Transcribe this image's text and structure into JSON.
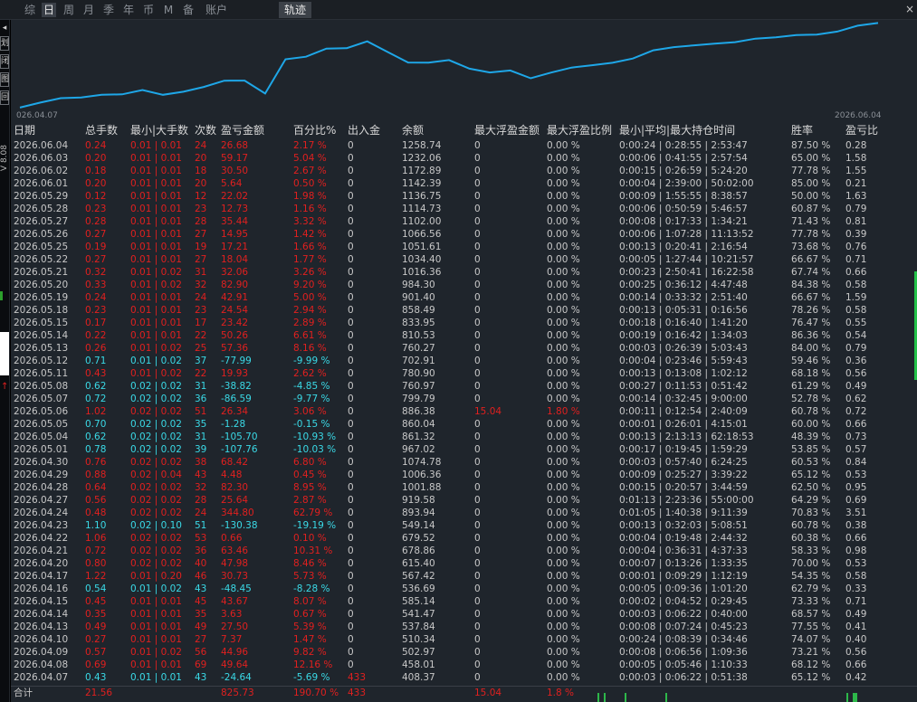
{
  "tabs": [
    "综",
    "日",
    "周",
    "月",
    "季",
    "年",
    "币",
    "M",
    "备",
    "账户"
  ],
  "active_tab": "日",
  "panel_title": "轨迹",
  "close_glyph": "×",
  "left_strip": {
    "arrow": "◂",
    "buttons": [
      "划",
      "闭",
      "图",
      "回"
    ],
    "version": "V 8.08",
    "red_arrow": "↑"
  },
  "colors": {
    "background": "#000000",
    "panel": "#1f252c",
    "line": "#1ea7e8",
    "positive": "#e0201f",
    "negative": "#3ad9e6",
    "neutral": "#c8c8c8"
  },
  "chart_data": {
    "type": "line",
    "title": "",
    "x_start_label": "026.04.07",
    "x_end_label": "2026.06.04",
    "x": [
      "2026.04.07",
      "2026.04.09",
      "2026.04.10",
      "2026.04.13",
      "2026.04.14",
      "2026.04.15",
      "2026.04.16",
      "2026.04.17",
      "2026.04.20",
      "2026.04.21",
      "2026.04.22",
      "2026.04.23",
      "2026.04.24",
      "2026.04.27",
      "2026.04.28",
      "2026.04.29",
      "2026.04.30",
      "2026.05.01",
      "2026.05.04",
      "2026.05.05",
      "2026.05.06",
      "2026.05.07",
      "2026.05.08",
      "2026.05.11",
      "2026.05.12",
      "2026.05.13",
      "2026.05.14",
      "2026.05.15",
      "2026.05.18",
      "2026.05.19",
      "2026.05.20",
      "2026.05.21",
      "2026.05.22",
      "2026.05.25",
      "2026.05.26",
      "2026.05.27",
      "2026.05.28",
      "2026.05.29",
      "2026.06.01",
      "2026.06.02",
      "2026.06.03",
      "2026.06.04"
    ],
    "y": [
      408.37,
      458.01,
      502.97,
      510.34,
      537.84,
      541.47,
      585.14,
      536.69,
      567.42,
      615.4,
      678.86,
      679.52,
      549.14,
      893.94,
      919.58,
      1001.88,
      1006.36,
      1074.78,
      967.02,
      861.32,
      860.04,
      886.38,
      799.79,
      760.97,
      780.9,
      702.91,
      760.27,
      810.53,
      833.95,
      858.49,
      901.4,
      984.3,
      1016.36,
      1034.4,
      1051.61,
      1066.56,
      1102.0,
      1114.73,
      1136.75,
      1142.39,
      1172.89,
      1232.06,
      1258.74
    ],
    "ylim": [
      380,
      1290
    ],
    "grid": false
  },
  "table": {
    "headers": [
      "日期",
      "总手数",
      "最小|大手数",
      "次数",
      "盈亏金额",
      "百分比%",
      "出入金",
      "余额",
      "最大浮盈金额",
      "最大浮盈比例",
      "最小|平均|最大持仓时间",
      "胜率",
      "盈亏比"
    ],
    "rows": [
      [
        "2026.06.04",
        "0.24",
        "0.01 | 0.01",
        "24",
        "26.68",
        "2.17 %",
        "0",
        "1258.74",
        "0",
        "0.00 %",
        "0:00:24 | 0:28:55 | 2:53:47",
        "87.50 %",
        "0.28",
        "pos"
      ],
      [
        "2026.06.03",
        "0.20",
        "0.01 | 0.01",
        "20",
        "59.17",
        "5.04 %",
        "0",
        "1232.06",
        "0",
        "0.00 %",
        "0:00:06 | 0:41:55 | 2:57:54",
        "65.00 %",
        "1.58",
        "pos"
      ],
      [
        "2026.06.02",
        "0.18",
        "0.01 | 0.01",
        "18",
        "30.50",
        "2.67 %",
        "0",
        "1172.89",
        "0",
        "0.00 %",
        "0:00:15 | 0:26:59 | 5:24:20",
        "77.78 %",
        "1.55",
        "pos"
      ],
      [
        "2026.06.01",
        "0.20",
        "0.01 | 0.01",
        "20",
        "5.64",
        "0.50 %",
        "0",
        "1142.39",
        "0",
        "0.00 %",
        "0:00:04 | 2:39:00 | 50:02:00",
        "85.00 %",
        "0.21",
        "pos"
      ],
      [
        "2026.05.29",
        "0.12",
        "0.01 | 0.01",
        "12",
        "22.02",
        "1.98 %",
        "0",
        "1136.75",
        "0",
        "0.00 %",
        "0:00:09 | 1:55:55 | 8:38:57",
        "50.00 %",
        "1.63",
        "pos"
      ],
      [
        "2026.05.28",
        "0.23",
        "0.01 | 0.01",
        "23",
        "12.73",
        "1.16 %",
        "0",
        "1114.73",
        "0",
        "0.00 %",
        "0:00:06 | 0:50:59 | 5:46:57",
        "60.87 %",
        "0.79",
        "pos"
      ],
      [
        "2026.05.27",
        "0.28",
        "0.01 | 0.01",
        "28",
        "35.44",
        "3.32 %",
        "0",
        "1102.00",
        "0",
        "0.00 %",
        "0:00:08 | 0:17:33 | 1:34:21",
        "71.43 %",
        "0.81",
        "pos"
      ],
      [
        "2026.05.26",
        "0.27",
        "0.01 | 0.01",
        "27",
        "14.95",
        "1.42 %",
        "0",
        "1066.56",
        "0",
        "0.00 %",
        "0:00:06 | 1:07:28 | 11:13:52",
        "77.78 %",
        "0.39",
        "pos"
      ],
      [
        "2026.05.25",
        "0.19",
        "0.01 | 0.01",
        "19",
        "17.21",
        "1.66 %",
        "0",
        "1051.61",
        "0",
        "0.00 %",
        "0:00:13 | 0:20:41 | 2:16:54",
        "73.68 %",
        "0.76",
        "pos"
      ],
      [
        "2026.05.22",
        "0.27",
        "0.01 | 0.01",
        "27",
        "18.04",
        "1.77 %",
        "0",
        "1034.40",
        "0",
        "0.00 %",
        "0:00:05 | 1:27:44 | 10:21:57",
        "66.67 %",
        "0.71",
        "pos"
      ],
      [
        "2026.05.21",
        "0.32",
        "0.01 | 0.02",
        "31",
        "32.06",
        "3.26 %",
        "0",
        "1016.36",
        "0",
        "0.00 %",
        "0:00:23 | 2:50:41 | 16:22:58",
        "67.74 %",
        "0.66",
        "pos"
      ],
      [
        "2026.05.20",
        "0.33",
        "0.01 | 0.02",
        "32",
        "82.90",
        "9.20 %",
        "0",
        "984.30",
        "0",
        "0.00 %",
        "0:00:25 | 0:36:12 | 4:47:48",
        "84.38 %",
        "0.58",
        "pos"
      ],
      [
        "2026.05.19",
        "0.24",
        "0.01 | 0.01",
        "24",
        "42.91",
        "5.00 %",
        "0",
        "901.40",
        "0",
        "0.00 %",
        "0:00:14 | 0:33:32 | 2:51:40",
        "66.67 %",
        "1.59",
        "pos"
      ],
      [
        "2026.05.18",
        "0.23",
        "0.01 | 0.01",
        "23",
        "24.54",
        "2.94 %",
        "0",
        "858.49",
        "0",
        "0.00 %",
        "0:00:13 | 0:05:31 | 0:16:56",
        "78.26 %",
        "0.58",
        "pos"
      ],
      [
        "2026.05.15",
        "0.17",
        "0.01 | 0.01",
        "17",
        "23.42",
        "2.89 %",
        "0",
        "833.95",
        "0",
        "0.00 %",
        "0:00:18 | 0:16:40 | 1:41:20",
        "76.47 %",
        "0.55",
        "pos"
      ],
      [
        "2026.05.14",
        "0.22",
        "0.01 | 0.01",
        "22",
        "50.26",
        "6.61 %",
        "0",
        "810.53",
        "0",
        "0.00 %",
        "0:00:19 | 0:16:42 | 1:34:03",
        "86.36 %",
        "0.54",
        "pos"
      ],
      [
        "2026.05.13",
        "0.26",
        "0.01 | 0.02",
        "25",
        "57.36",
        "8.16 %",
        "0",
        "760.27",
        "0",
        "0.00 %",
        "0:00:03 | 0:26:39 | 5:03:43",
        "84.00 %",
        "0.79",
        "pos"
      ],
      [
        "2026.05.12",
        "0.71",
        "0.01 | 0.02",
        "37",
        "-77.99",
        "-9.99 %",
        "0",
        "702.91",
        "0",
        "0.00 %",
        "0:00:04 | 0:23:46 | 5:59:43",
        "59.46 %",
        "0.36",
        "neg"
      ],
      [
        "2026.05.11",
        "0.43",
        "0.01 | 0.02",
        "22",
        "19.93",
        "2.62 %",
        "0",
        "780.90",
        "0",
        "0.00 %",
        "0:00:13 | 0:13:08 | 1:02:12",
        "68.18 %",
        "0.56",
        "pos"
      ],
      [
        "2026.05.08",
        "0.62",
        "0.02 | 0.02",
        "31",
        "-38.82",
        "-4.85 %",
        "0",
        "760.97",
        "0",
        "0.00 %",
        "0:00:27 | 0:11:53 | 0:51:42",
        "61.29 %",
        "0.49",
        "neg"
      ],
      [
        "2026.05.07",
        "0.72",
        "0.02 | 0.02",
        "36",
        "-86.59",
        "-9.77 %",
        "0",
        "799.79",
        "0",
        "0.00 %",
        "0:00:14 | 0:32:45 | 9:00:00",
        "52.78 %",
        "0.62",
        "neg"
      ],
      [
        "2026.05.06",
        "1.02",
        "0.02 | 0.02",
        "51",
        "26.34",
        "3.06 %",
        "0",
        "886.38",
        "15.04",
        "1.80 %",
        "0:00:11 | 0:12:54 | 2:40:09",
        "60.78 %",
        "0.72",
        "pos"
      ],
      [
        "2026.05.05",
        "0.70",
        "0.02 | 0.02",
        "35",
        "-1.28",
        "-0.15 %",
        "0",
        "860.04",
        "0",
        "0.00 %",
        "0:00:01 | 0:26:01 | 4:15:01",
        "60.00 %",
        "0.66",
        "neg"
      ],
      [
        "2026.05.04",
        "0.62",
        "0.02 | 0.02",
        "31",
        "-105.70",
        "-10.93 %",
        "0",
        "861.32",
        "0",
        "0.00 %",
        "0:00:13 | 2:13:13 | 62:18:53",
        "48.39 %",
        "0.73",
        "neg"
      ],
      [
        "2026.05.01",
        "0.78",
        "0.02 | 0.02",
        "39",
        "-107.76",
        "-10.03 %",
        "0",
        "967.02",
        "0",
        "0.00 %",
        "0:00:17 | 0:19:45 | 1:59:29",
        "53.85 %",
        "0.57",
        "neg"
      ],
      [
        "2026.04.30",
        "0.76",
        "0.02 | 0.02",
        "38",
        "68.42",
        "6.80 %",
        "0",
        "1074.78",
        "0",
        "0.00 %",
        "0:00:03 | 0:57:40 | 6:24:25",
        "60.53 %",
        "0.84",
        "pos"
      ],
      [
        "2026.04.29",
        "0.88",
        "0.02 | 0.04",
        "43",
        "4.48",
        "0.45 %",
        "0",
        "1006.36",
        "0",
        "0.00 %",
        "0:00:09 | 0:25:27 | 3:39:22",
        "65.12 %",
        "0.53",
        "pos"
      ],
      [
        "2026.04.28",
        "0.64",
        "0.02 | 0.02",
        "32",
        "82.30",
        "8.95 %",
        "0",
        "1001.88",
        "0",
        "0.00 %",
        "0:00:15 | 0:20:57 | 3:44:59",
        "62.50 %",
        "0.95",
        "pos"
      ],
      [
        "2026.04.27",
        "0.56",
        "0.02 | 0.02",
        "28",
        "25.64",
        "2.87 %",
        "0",
        "919.58",
        "0",
        "0.00 %",
        "0:01:13 | 2:23:36 | 55:00:00",
        "64.29 %",
        "0.69",
        "pos"
      ],
      [
        "2026.04.24",
        "0.48",
        "0.02 | 0.02",
        "24",
        "344.80",
        "62.79 %",
        "0",
        "893.94",
        "0",
        "0.00 %",
        "0:01:05 | 1:40:38 | 9:11:39",
        "70.83 %",
        "3.51",
        "pos"
      ],
      [
        "2026.04.23",
        "1.10",
        "0.02 | 0.10",
        "51",
        "-130.38",
        "-19.19 %",
        "0",
        "549.14",
        "0",
        "0.00 %",
        "0:00:13 | 0:32:03 | 5:08:51",
        "60.78 %",
        "0.38",
        "neg"
      ],
      [
        "2026.04.22",
        "1.06",
        "0.02 | 0.02",
        "53",
        "0.66",
        "0.10 %",
        "0",
        "679.52",
        "0",
        "0.00 %",
        "0:00:04 | 0:19:48 | 2:44:32",
        "60.38 %",
        "0.66",
        "pos"
      ],
      [
        "2026.04.21",
        "0.72",
        "0.02 | 0.02",
        "36",
        "63.46",
        "10.31 %",
        "0",
        "678.86",
        "0",
        "0.00 %",
        "0:00:04 | 0:36:31 | 4:37:33",
        "58.33 %",
        "0.98",
        "pos"
      ],
      [
        "2026.04.20",
        "0.80",
        "0.02 | 0.02",
        "40",
        "47.98",
        "8.46 %",
        "0",
        "615.40",
        "0",
        "0.00 %",
        "0:00:07 | 0:13:26 | 1:33:35",
        "70.00 %",
        "0.53",
        "pos"
      ],
      [
        "2026.04.17",
        "1.22",
        "0.01 | 0.20",
        "46",
        "30.73",
        "5.73 %",
        "0",
        "567.42",
        "0",
        "0.00 %",
        "0:00:01 | 0:09:29 | 1:12:19",
        "54.35 %",
        "0.58",
        "pos"
      ],
      [
        "2026.04.16",
        "0.54",
        "0.01 | 0.02",
        "43",
        "-48.45",
        "-8.28 %",
        "0",
        "536.69",
        "0",
        "0.00 %",
        "0:00:05 | 0:09:36 | 1:01:20",
        "62.79 %",
        "0.33",
        "neg"
      ],
      [
        "2026.04.15",
        "0.45",
        "0.01 | 0.01",
        "45",
        "43.67",
        "8.07 %",
        "0",
        "585.14",
        "0",
        "0.00 %",
        "0:00:02 | 0:04:52 | 0:29:45",
        "73.33 %",
        "0.71",
        "pos"
      ],
      [
        "2026.04.14",
        "0.35",
        "0.01 | 0.01",
        "35",
        "3.63",
        "0.67 %",
        "0",
        "541.47",
        "0",
        "0.00 %",
        "0:00:03 | 0:06:22 | 0:40:00",
        "68.57 %",
        "0.49",
        "pos"
      ],
      [
        "2026.04.13",
        "0.49",
        "0.01 | 0.01",
        "49",
        "27.50",
        "5.39 %",
        "0",
        "537.84",
        "0",
        "0.00 %",
        "0:00:08 | 0:07:24 | 0:45:23",
        "77.55 %",
        "0.41",
        "pos"
      ],
      [
        "2026.04.10",
        "0.27",
        "0.01 | 0.01",
        "27",
        "7.37",
        "1.47 %",
        "0",
        "510.34",
        "0",
        "0.00 %",
        "0:00:24 | 0:08:39 | 0:34:46",
        "74.07 %",
        "0.40",
        "pos"
      ],
      [
        "2026.04.09",
        "0.57",
        "0.01 | 0.02",
        "56",
        "44.96",
        "9.82 %",
        "0",
        "502.97",
        "0",
        "0.00 %",
        "0:00:08 | 0:06:56 | 1:09:36",
        "73.21 %",
        "0.56",
        "pos"
      ],
      [
        "2026.04.08",
        "0.69",
        "0.01 | 0.01",
        "69",
        "49.64",
        "12.16 %",
        "0",
        "458.01",
        "0",
        "0.00 %",
        "0:00:05 | 0:05:46 | 1:10:33",
        "68.12 %",
        "0.66",
        "pos"
      ],
      [
        "2026.04.07",
        "0.43",
        "0.01 | 0.01",
        "43",
        "-24.64",
        "-5.69 %",
        "433",
        "408.37",
        "0",
        "0.00 %",
        "0:00:03 | 0:06:22 | 0:51:38",
        "65.12 %",
        "0.42",
        "neg"
      ]
    ],
    "total": {
      "label": "合计",
      "total_lots": "21.56",
      "pnl": "825.73",
      "pct": "190.70 %",
      "deposit": "433",
      "max_float": "15.04",
      "max_float_pct": "1.8 %"
    }
  }
}
